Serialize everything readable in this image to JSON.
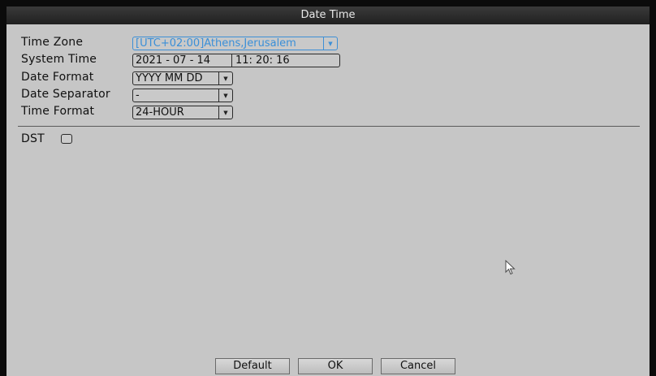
{
  "window": {
    "title": "Date Time"
  },
  "form": {
    "time_zone": {
      "label": "Time Zone",
      "value": "[UTC+02:00]Athens,Jerusalem"
    },
    "system_time": {
      "label": "System Time",
      "date": "2021 - 07 - 14",
      "time": "11: 20: 16"
    },
    "date_format": {
      "label": "Date Format",
      "value": "YYYY MM DD"
    },
    "date_separator": {
      "label": "Date Separator",
      "value": "-"
    },
    "time_format": {
      "label": "Time Format",
      "value": "24-HOUR"
    },
    "dst": {
      "label": "DST",
      "checked": false
    }
  },
  "buttons": {
    "default": "Default",
    "ok": "OK",
    "cancel": "Cancel"
  },
  "colors": {
    "active_border": "#3d8fd6",
    "active_text": "#3a8fd8",
    "background": "#c6c6c6",
    "titlebar": "#202020"
  },
  "icons": {
    "dropdown": "chevron-down-icon",
    "pointer": "mouse-pointer-icon"
  }
}
